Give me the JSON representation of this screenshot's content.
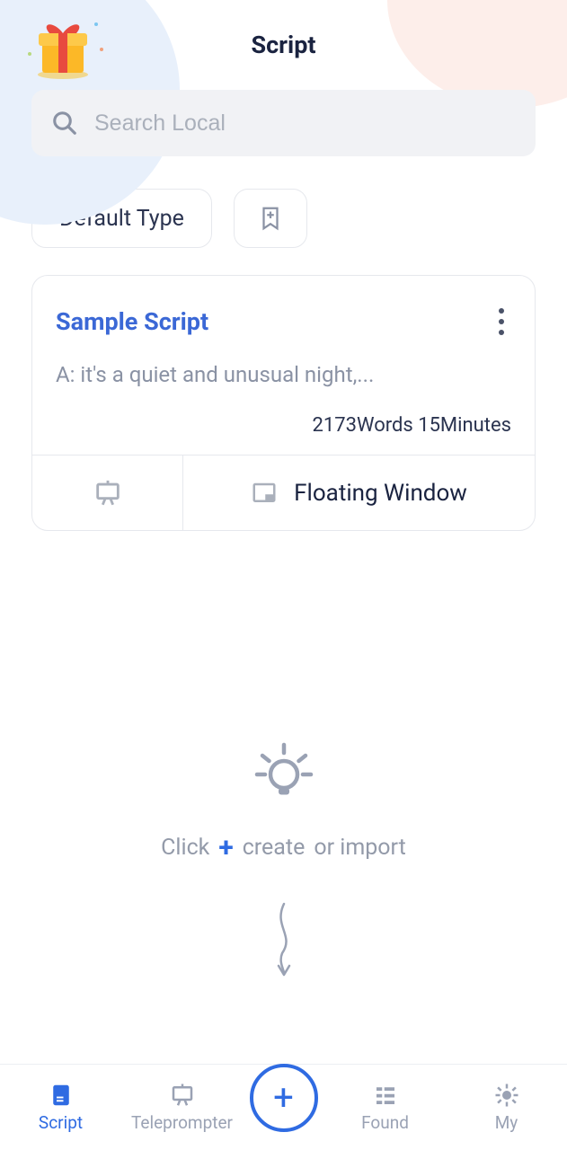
{
  "header": {
    "title": "Script"
  },
  "search": {
    "placeholder": "Search Local"
  },
  "filters": {
    "default_label": "Default Type"
  },
  "card": {
    "title": "Sample Script",
    "preview": "A: it's a quiet and unusual night,...",
    "stats": "2173Words 15Minutes",
    "floating_label": "Floating Window"
  },
  "hint": {
    "click": "Click",
    "plus": "+",
    "create": "create",
    "or_import": "or import"
  },
  "nav": {
    "script": "Script",
    "teleprompter": "Teleprompter",
    "found": "Found",
    "my": "My"
  }
}
